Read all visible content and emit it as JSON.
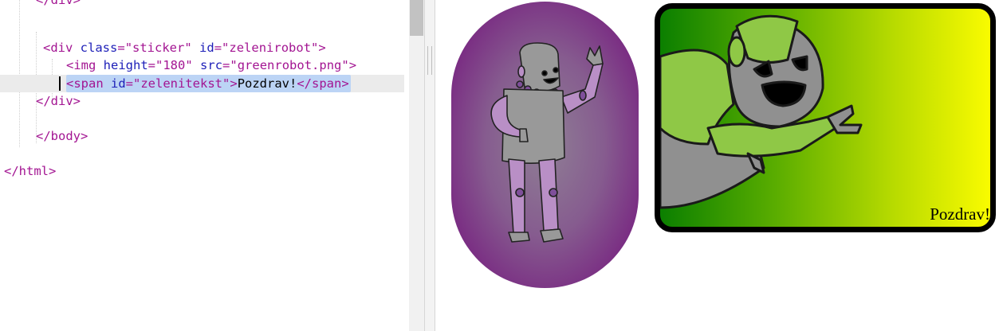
{
  "editor": {
    "lines": [
      {
        "tokens": [
          {
            "t": "tag",
            "v": "</div>"
          }
        ]
      },
      {
        "tokens": []
      },
      {
        "tokens": [
          {
            "t": "tag",
            "v": "<div "
          },
          {
            "t": "attr",
            "v": "class"
          },
          {
            "t": "tag",
            "v": "="
          },
          {
            "t": "str",
            "v": "\"sticker\""
          },
          {
            "t": "txt",
            "v": " "
          },
          {
            "t": "attr",
            "v": "id"
          },
          {
            "t": "tag",
            "v": "="
          },
          {
            "t": "str",
            "v": "\"zelenirobot\""
          },
          {
            "t": "tag",
            "v": ">"
          }
        ]
      },
      {
        "tokens": [
          {
            "t": "tag",
            "v": "<img "
          },
          {
            "t": "attr",
            "v": "height"
          },
          {
            "t": "tag",
            "v": "="
          },
          {
            "t": "str",
            "v": "\"180\""
          },
          {
            "t": "txt",
            "v": " "
          },
          {
            "t": "attr",
            "v": "src"
          },
          {
            "t": "tag",
            "v": "="
          },
          {
            "t": "str",
            "v": "\"greenrobot.png\""
          },
          {
            "t": "tag",
            "v": ">"
          }
        ]
      },
      {
        "tokens": [
          {
            "t": "tag",
            "v": "<span "
          },
          {
            "t": "attr",
            "v": "id"
          },
          {
            "t": "tag",
            "v": "="
          },
          {
            "t": "str",
            "v": "\"zelenitekst\""
          },
          {
            "t": "tag",
            "v": ">"
          },
          {
            "t": "txt",
            "v": "Pozdrav!"
          },
          {
            "t": "tag",
            "v": "</span>"
          }
        ]
      },
      {
        "tokens": [
          {
            "t": "tag",
            "v": "</div>"
          }
        ]
      },
      {
        "tokens": []
      },
      {
        "tokens": [
          {
            "t": "tag",
            "v": "</body>"
          }
        ]
      },
      {
        "tokens": []
      },
      {
        "tokens": [
          {
            "t": "tag",
            "v": "</html>"
          }
        ]
      }
    ]
  },
  "preview": {
    "green_sticker_text": "Pozdrav!",
    "purple_sticker_image": "purple-robot-waving",
    "green_sticker_image": "green-robot-reaching"
  },
  "colors": {
    "tag": "#a31592",
    "attr": "#1d1fb8",
    "selection": "#bcd4f5",
    "current_line": "#ebebeb",
    "purple_sticker": "#762582",
    "green_start": "#0b7f00",
    "green_end": "#f9fb00"
  }
}
